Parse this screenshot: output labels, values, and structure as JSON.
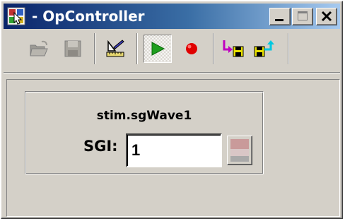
{
  "window": {
    "title": "- OpController",
    "app_icon": "opcontroller-app-icon",
    "caption_buttons": [
      "minimize-icon",
      "maximize-icon",
      "close-icon"
    ]
  },
  "toolbar": {
    "buttons": [
      {
        "name": "open-folder-icon",
        "enabled": false
      },
      {
        "name": "save-disk-icon",
        "enabled": false
      },
      {
        "name": "edit-ruler-icon",
        "enabled": true
      },
      {
        "name": "play-icon",
        "enabled": true,
        "pressed": true
      },
      {
        "name": "record-icon",
        "enabled": true
      },
      {
        "name": "save-to-disk-icon",
        "enabled": true
      },
      {
        "name": "load-from-disk-icon",
        "enabled": true
      }
    ]
  },
  "group": {
    "title": "stim.sgWave1",
    "sgi_label": "SGI:",
    "sgi_value": "1"
  },
  "colors": {
    "title_bar_start": "#0a246a",
    "title_bar_end": "#a6caf0",
    "face": "#d4d0c8",
    "play": "#1e9e1e",
    "record": "#e00000",
    "magenta": "#c000c0",
    "cyan": "#00c8e0"
  }
}
